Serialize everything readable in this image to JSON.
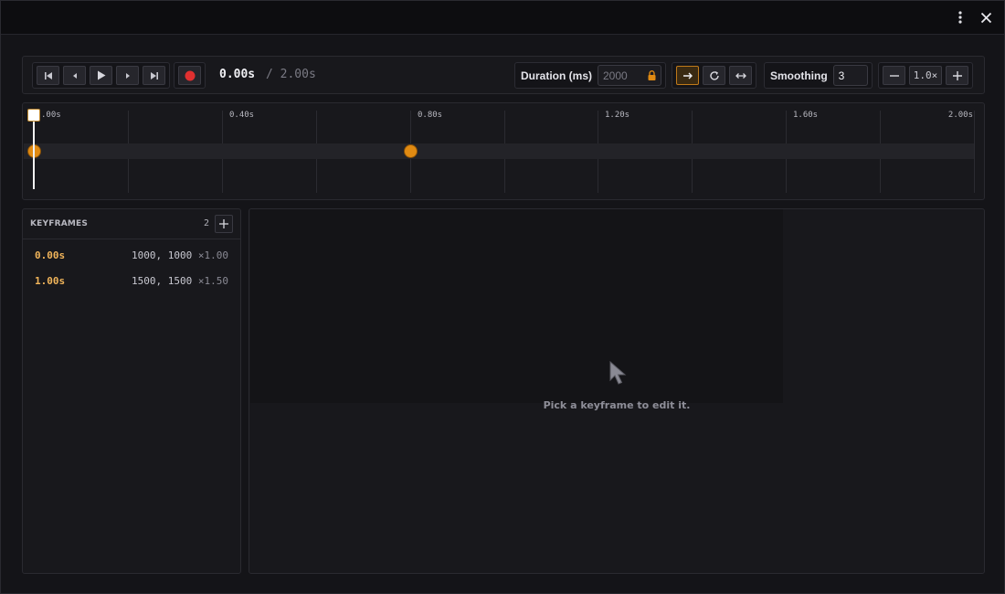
{
  "window": {
    "menu_icon": "more-vertical-icon",
    "close_icon": "close-icon"
  },
  "toolbar": {
    "transport_icons": [
      "skip-to-start-icon",
      "step-back-icon",
      "play-icon",
      "step-forward-icon",
      "skip-to-end-icon"
    ],
    "record_icon": "record-icon",
    "current_time": "0.00s",
    "total_time": "/ 2.00s",
    "duration_label": "Duration (ms)",
    "duration_value": "2000",
    "duration_locked": true,
    "playback_modes": [
      {
        "icon": "arrow-right-icon",
        "active": true
      },
      {
        "icon": "loop-icon",
        "active": false
      },
      {
        "icon": "ping-pong-icon",
        "active": false
      }
    ],
    "smoothing_label": "Smoothing",
    "smoothing_value": "3",
    "zoom_value": "1.0×"
  },
  "timeline": {
    "duration_s": 2.0,
    "playhead_s": 0.0,
    "ticks": [
      ".00s",
      "0.40s",
      "0.80s",
      "1.20s",
      "1.60s",
      "2.00s"
    ],
    "keyframe_times_s": [
      0.0,
      0.8
    ]
  },
  "keyframes_panel": {
    "title": "KEYFRAMES",
    "count": "2",
    "rows": [
      {
        "time": "0.00s",
        "values": "1000, 1000",
        "scale": "×1.00"
      },
      {
        "time": "1.00s",
        "values": "1500, 1500",
        "scale": "×1.50"
      }
    ]
  },
  "editor": {
    "empty_icon": "cursor-pointer-icon",
    "empty_message": "Pick a keyframe to edit it."
  },
  "colors": {
    "accent": "#e08a12",
    "record": "#e03030",
    "background": "#141418"
  }
}
